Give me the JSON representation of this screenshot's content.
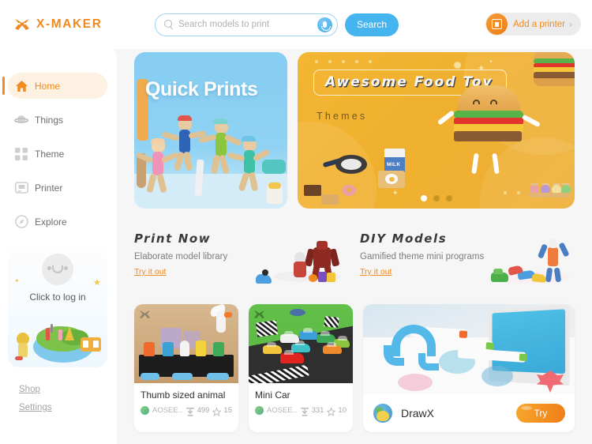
{
  "header": {
    "logo_text": "X-MAKER",
    "logo_icon": "x-maker-logo-icon",
    "search": {
      "placeholder": "Search models to print",
      "value": "",
      "icon": "search-icon",
      "mic_icon": "microphone-icon",
      "button_label": "Search"
    },
    "printer_button": {
      "label": "Add a printer",
      "icon": "printer-icon",
      "chevron": "›"
    }
  },
  "sidebar": {
    "items": [
      {
        "label": "Home",
        "icon": "home-icon",
        "active": true
      },
      {
        "label": "Things",
        "icon": "planet-icon",
        "active": false
      },
      {
        "label": "Theme",
        "icon": "grid-icon",
        "active": false
      },
      {
        "label": "Printer",
        "icon": "printer-icon",
        "active": false
      },
      {
        "label": "Explore",
        "icon": "compass-icon",
        "active": false
      }
    ],
    "login": {
      "text": "Click to log in",
      "avatar_icon": "smiley-avatar-icon"
    },
    "links": [
      {
        "label": "Shop"
      },
      {
        "label": "Settings"
      }
    ]
  },
  "banners": {
    "quick_prints": {
      "title": "Quick Prints"
    },
    "food_toy": {
      "title": "Awesome Food Toy",
      "subtitle": "Themes",
      "milk_label": "MILK",
      "dots": 3,
      "active_dot": 0
    }
  },
  "promos": [
    {
      "title": "Print Now",
      "desc": "Elaborate model library",
      "link": "Try it out"
    },
    {
      "title": "DIY Models",
      "desc": "Gamified theme mini programs",
      "link": "Try it out"
    }
  ],
  "cards": [
    {
      "title": "Thumb sized animal",
      "user": "AOSEE...",
      "downloads": "499",
      "likes": "15",
      "download_icon": "download-icon",
      "like_icon": "star-icon"
    },
    {
      "title": "Mini Car",
      "user": "AOSEE...",
      "downloads": "331",
      "likes": "10",
      "download_icon": "download-icon",
      "like_icon": "star-icon"
    }
  ],
  "featured": {
    "title": "DrawX",
    "button_label": "Try",
    "logo_icon": "drawx-logo-icon"
  },
  "colors": {
    "accent_orange": "#f08b20",
    "accent_blue": "#46b4ee",
    "banner_yellow": "#eeae35",
    "banner_blue": "#8fd2f3",
    "page_bg": "#f6f6f6"
  }
}
